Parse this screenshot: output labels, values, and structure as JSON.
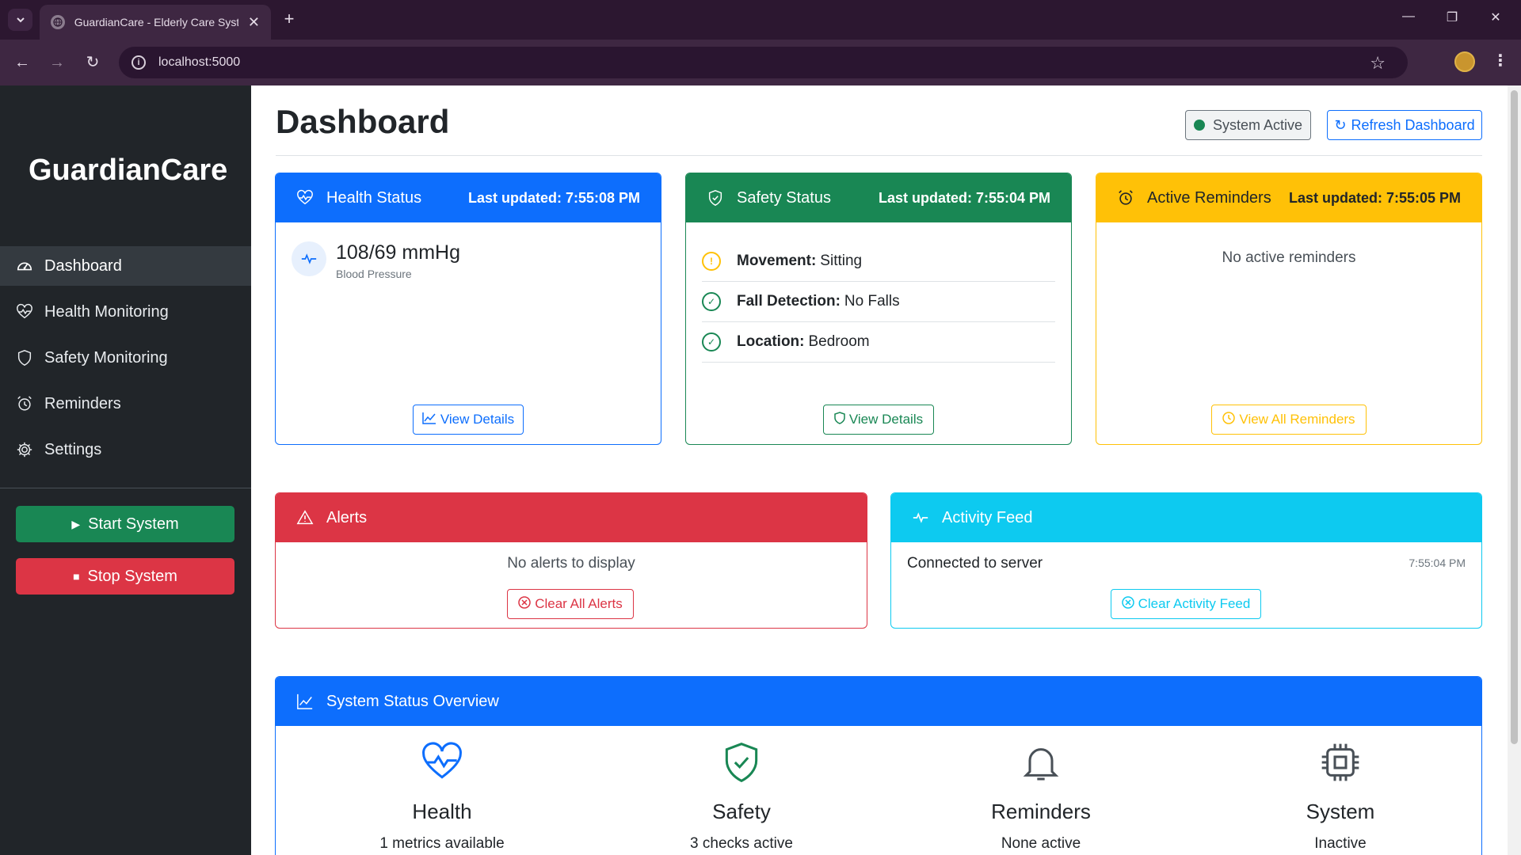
{
  "browser": {
    "tab_title": "GuardianCare - Elderly Care System",
    "url": "localhost:5000"
  },
  "sidebar": {
    "brand": "GuardianCare",
    "items": [
      {
        "label": "Dashboard",
        "icon": "speedometer-icon",
        "active": true
      },
      {
        "label": "Health Monitoring",
        "icon": "heart-pulse-icon"
      },
      {
        "label": "Safety Monitoring",
        "icon": "shield-icon"
      },
      {
        "label": "Reminders",
        "icon": "alarm-icon"
      },
      {
        "label": "Settings",
        "icon": "gear-icon"
      }
    ],
    "start_label": "Start System",
    "stop_label": "Stop System"
  },
  "header": {
    "title": "Dashboard",
    "status_label": "System Active",
    "refresh_label": "Refresh Dashboard"
  },
  "health": {
    "title": "Health Status",
    "updated": "Last updated: 7:55:08 PM",
    "value": "108/69 mmHg",
    "label": "Blood Pressure",
    "button": "View Details"
  },
  "safety": {
    "title": "Safety Status",
    "updated": "Last updated: 7:55:04 PM",
    "rows": [
      {
        "key": "Movement:",
        "value": "Sitting",
        "status": "warning"
      },
      {
        "key": "Fall Detection:",
        "value": "No Falls",
        "status": "ok"
      },
      {
        "key": "Location:",
        "value": "Bedroom",
        "status": "ok"
      }
    ],
    "button": "View Details"
  },
  "reminders": {
    "title": "Active Reminders",
    "updated": "Last updated: 7:55:05 PM",
    "empty": "No active reminders",
    "button": "View All Reminders"
  },
  "alerts": {
    "title": "Alerts",
    "empty": "No alerts to display",
    "button": "Clear All Alerts"
  },
  "feed": {
    "title": "Activity Feed",
    "message": "Connected to server",
    "time": "7:55:04 PM",
    "button": "Clear Activity Feed"
  },
  "overview": {
    "title": "System Status Overview",
    "items": [
      {
        "name": "Health",
        "sub": "1 metrics available",
        "icon": "heart-pulse-icon"
      },
      {
        "name": "Safety",
        "sub": "3 checks active",
        "icon": "shield-check-icon"
      },
      {
        "name": "Reminders",
        "sub": "None active",
        "icon": "bell-icon"
      },
      {
        "name": "System",
        "sub": "Inactive",
        "icon": "cpu-icon"
      }
    ]
  },
  "colors": {
    "primary": "#0d6efd",
    "success": "#198754",
    "warning": "#ffc107",
    "danger": "#dc3545",
    "info": "#0dcaf0",
    "sidebar": "#212529"
  }
}
